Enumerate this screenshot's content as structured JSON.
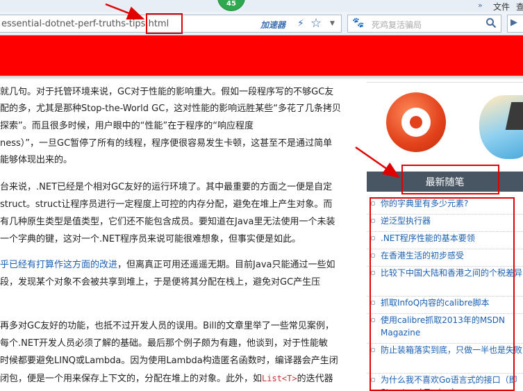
{
  "browser": {
    "menu": {
      "file": "文件",
      "view_partial": "查",
      "chevron": "»"
    },
    "tab_badge": "45",
    "address_bar": {
      "url_visible": "essential-dotnet-perf-truths-tips.html",
      "accelerator_label": "加速器"
    },
    "search": {
      "placeholder": "死鸡复活骗局"
    }
  },
  "article": {
    "lines": [
      {
        "text": "就几句。对于托管环境来说，GC对于性能的影响重大。假如一段程序写的不够GC友"
      },
      {
        "text": "配的多，尤其是那种Stop-the-World GC，这对性能的影响远胜某些“多花了几条拷贝"
      },
      {
        "text": "探索”。而且很多时候，用户眼中的“性能”在于程序的“响应程度"
      },
      {
        "text": "ness）”，一旦GC暂停了所有的线程，程序便很容易发生卡顿，这甚至不是通过简单"
      },
      {
        "text": "能够体现出来的。"
      },
      {
        "text": "台来说，.NET已经是个相对GC友好的运行环境了。其中最重要的方面之一便是自定"
      },
      {
        "text": "struct。struct让程序员进行一定程度上可控的内存分配，避免在堆上产生对象。而"
      },
      {
        "text": "有几种原生类型是值类型，它们还不能包含成员。要知道在Java里无法使用一个未装"
      },
      {
        "text": "一个字典的键，这对一个.NET程序员来说可能很难想象，但事实便是如此。"
      },
      {
        "link": "乎已经有打算作这方面的改进",
        "text": "，但离真正可用还遥遥无期。目前Java只能通过一些如"
      },
      {
        "text": "段，发现某个对象不会被共享到堆上，于是便将其分配在栈上，避免对GC产生压"
      },
      {
        "text": "再多对GC友好的功能，也抵不过开发人员的误用。Bill的文章里举了一些常见案例，"
      },
      {
        "text": "每个.NET开发人员必须了解的基础。最后那个例子颇为有趣，他谈到，对于性能敏"
      },
      {
        "text": "时候都要避免LINQ或Lambda。因为使用Lambda构造匿名函数时，编译器会产生闭"
      },
      {
        "text": "闭包，便是一个用来保存上下文的，分配在堆上的对象。此外，如",
        "code": "List<T>",
        "tail": "的迭代器"
      }
    ]
  },
  "sidebar": {
    "heading": "最新随笔",
    "posts": [
      {
        "label": "你的字典里有多少元素?"
      },
      {
        "label": "逆泛型执行器"
      },
      {
        "label": ".NET程序性能的基本要领"
      },
      {
        "label": "在香港生活的初步感受"
      },
      {
        "label": "比较下中国大陆和香港之间的个税差异"
      },
      {
        "label": "抓取InfoQ内容的calibre脚本"
      },
      {
        "label": "使用calibre抓取2013年的MSDN Magazine"
      },
      {
        "label": "防止装箱落实到底，只做一半也是失败"
      },
      {
        "label": "为什么我不喜欢Go语言式的接口（即Structural Typing）"
      }
    ]
  },
  "colors": {
    "banner": "#ff0000",
    "annotation": "#e00000",
    "sidebar_heading_bg": "#485664",
    "link": "#1a5fb4",
    "tab_badge": "#2fa84f"
  }
}
